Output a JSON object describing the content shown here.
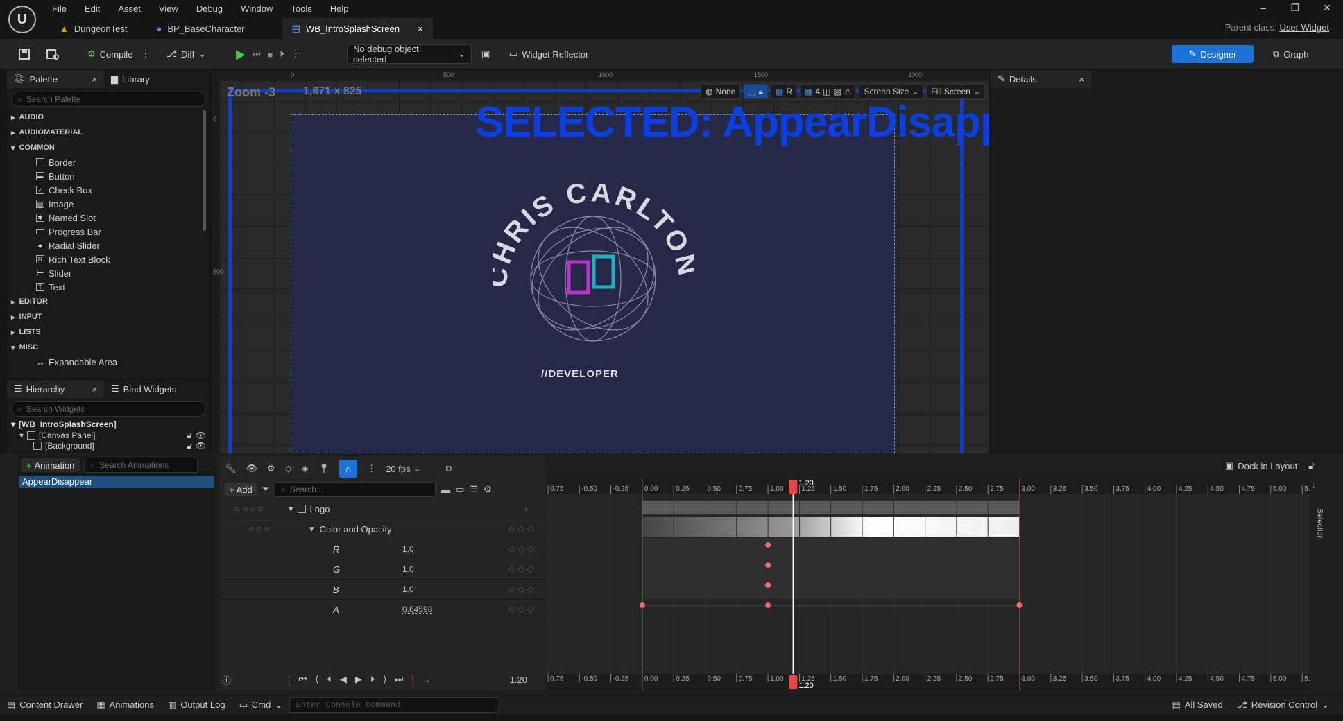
{
  "menu": [
    "File",
    "Edit",
    "Asset",
    "View",
    "Debug",
    "Window",
    "Tools",
    "Help"
  ],
  "tabs": [
    {
      "label": "DungeonTest"
    },
    {
      "label": "BP_BaseCharacter"
    },
    {
      "label": "WB_IntroSplashScreen"
    }
  ],
  "parent_class": {
    "label": "Parent class:",
    "value": "User Widget"
  },
  "toolbar": {
    "compile": "Compile",
    "diff": "Diff",
    "debug_object": "No debug object selected",
    "widget_reflector": "Widget Reflector",
    "designer": "Designer",
    "graph": "Graph"
  },
  "palette": {
    "tab": "Palette",
    "library_tab": "Library",
    "search_placeholder": "Search Palette",
    "categories": {
      "audio": "AUDIO",
      "audiomaterial": "AUDIOMATERIAL",
      "common": "COMMON",
      "editor": "EDITOR",
      "input": "INPUT",
      "lists": "LISTS",
      "misc": "MISC"
    },
    "common_items": [
      "Border",
      "Button",
      "Check Box",
      "Image",
      "Named Slot",
      "Progress Bar",
      "Radial Slider",
      "Rich Text Block",
      "Slider",
      "Text"
    ],
    "misc_items": [
      "Expandable Area"
    ]
  },
  "hierarchy": {
    "tab": "Hierarchy",
    "bind_tab": "Bind Widgets",
    "search_placeholder": "Search Widgets",
    "items": [
      "[WB_IntroSplashScreen]",
      "[Canvas Panel]",
      "[Background]"
    ]
  },
  "canvas": {
    "zoom": "Zoom -3",
    "resolution": "1,871 x 825",
    "selected": "SELECTED: AppearDisappear",
    "ruler": [
      "0",
      "500",
      "1000",
      "1500",
      "2000"
    ],
    "ruler_v": [
      "0",
      "500"
    ],
    "logo_text": "CHRIS CARLTON",
    "logo_sub": "//DEVELOPER",
    "none_label": "None",
    "r_label": "R",
    "grid_num": "4",
    "screen_size": "Screen Size",
    "fill_screen": "Fill Screen"
  },
  "details": {
    "tab": "Details"
  },
  "animations": {
    "add": "Animation",
    "search_placeholder": "Search Animations",
    "items": [
      "AppearDisappear"
    ]
  },
  "sequencer": {
    "fps": "20 fps",
    "add": "Add",
    "search_placeholder": "Search...",
    "current_time": "1.20",
    "dock": "Dock in Layout",
    "selection": "Selection",
    "tracks": {
      "logo": "Logo",
      "color": "Color and Opacity",
      "channels": [
        {
          "name": "R",
          "value": "1.0"
        },
        {
          "name": "G",
          "value": "1.0"
        },
        {
          "name": "B",
          "value": "1.0"
        },
        {
          "name": "A",
          "value": "0.64598"
        }
      ]
    },
    "ticks": [
      "0.75",
      "-0.50",
      "-0.25",
      "0.00",
      "0.25",
      "0.50",
      "0.75",
      "1.00",
      "1.25",
      "1.50",
      "1.75",
      "2.00",
      "2.25",
      "2.50",
      "2.75",
      "3.00",
      "3.25",
      "3.50",
      "3.75",
      "4.00",
      "4.25",
      "4.50",
      "4.75",
      "5.00",
      "5."
    ],
    "playhead": "1.20"
  },
  "statusbar": {
    "content_drawer": "Content Drawer",
    "animations": "Animations",
    "output_log": "Output Log",
    "cmd": "Cmd",
    "console_placeholder": "Enter Console Command",
    "saved": "All Saved",
    "revision": "Revision Control"
  },
  "colors": {
    "accent": "#1a73d9",
    "selection": "#0b3fe0",
    "widget_bg": "#272748",
    "key": "#f06a6a"
  }
}
